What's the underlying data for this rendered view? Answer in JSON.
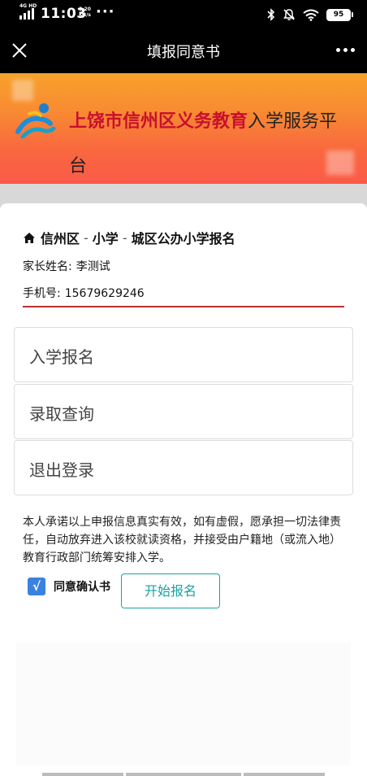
{
  "status_bar": {
    "network": "4G HD",
    "time": "11:03",
    "speed_value": "2.20",
    "speed_unit": "KB/s",
    "overflow": "···",
    "battery": "95",
    "icons": [
      "bluetooth-icon",
      "mute-icon",
      "wifi-icon",
      "battery-icon"
    ]
  },
  "title_bar": {
    "title": "填报同意书",
    "close_icon": "close-icon",
    "more_icon": "more-icon"
  },
  "banner": {
    "title_strong": "上饶市信州区义务教育",
    "title_rest": "入学服务平",
    "title_line2": "台",
    "colors": {
      "top": "#f7a22b",
      "bottom": "#fa5a48",
      "title_strong": "#c8102e"
    }
  },
  "card": {
    "breadcrumb": [
      "信州区",
      "小学",
      "城区公办小学报名"
    ],
    "breadcrumb_sep": "-",
    "parent_label": "家长姓名:",
    "parent_value": "李测试",
    "phone_label": "手机号:",
    "phone_value": "15679629246",
    "menu": [
      {
        "label": "入学报名"
      },
      {
        "label": "录取查询"
      },
      {
        "label": "退出登录"
      }
    ]
  },
  "consent": {
    "text": "本人承诺以上申报信息真实有效，如有虚假，愿承担一切法律责任，自动放弃进入该校就读资格，并接受由户籍地（或流入地）教育行政部门统筹安排入学。",
    "checkbox_checked": true,
    "check_mark": "√",
    "agree_label": "同意确认书",
    "start_button": "开始报名",
    "colors": {
      "checkbox": "#3a82e0",
      "button": "#1aa3a0"
    }
  }
}
